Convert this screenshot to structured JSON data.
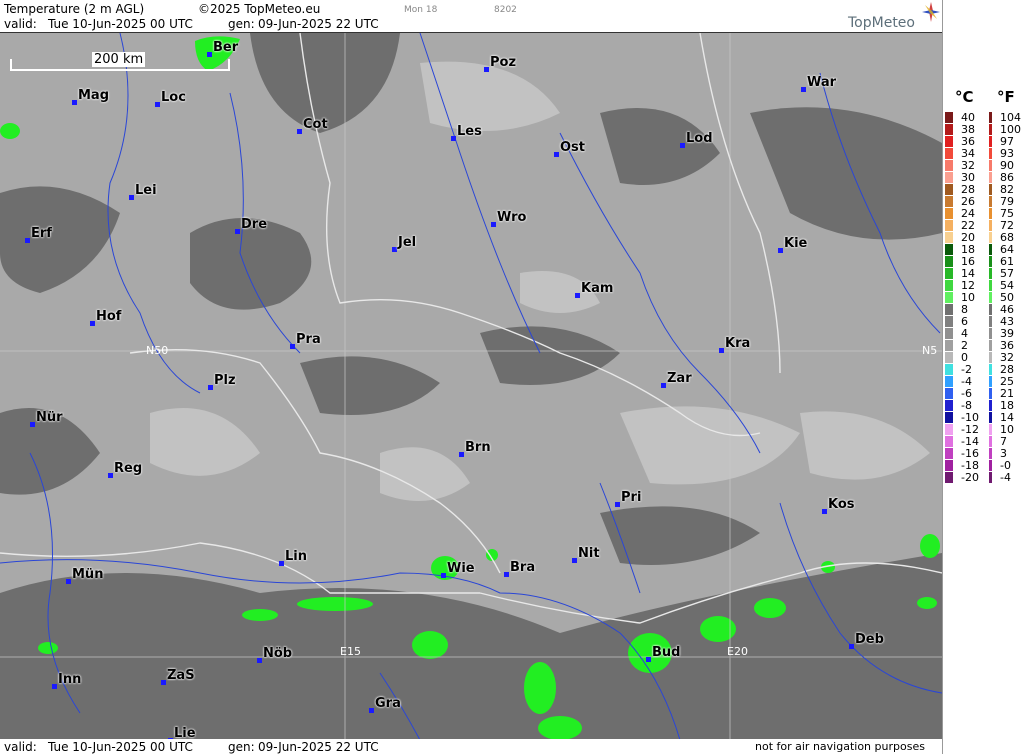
{
  "header": {
    "title": "Temperature (2 m AGL)",
    "copyright": "©2025 TopMeteo.eu",
    "model": "Mon 18",
    "code": "8202",
    "valid_label": "valid:",
    "valid_value": "Tue  10-Jun-2025  00 UTC",
    "gen_label": "gen:",
    "gen_value": "09-Jun-2025 22 UTC",
    "logo": "TopMeteo"
  },
  "footer": {
    "valid_label": "valid:",
    "valid_value": "Tue  10-Jun-2025  00 UTC",
    "gen_label": "gen:",
    "gen_value": "09-Jun-2025 22 UTC",
    "disclaimer": "not for air navigation purposes"
  },
  "map": {
    "scale": "200 km",
    "grid_labels": [
      "N50",
      "N5",
      "E15",
      "E20"
    ],
    "cities": [
      "Ber",
      "Poz",
      "War",
      "Mag",
      "Loc",
      "Cot",
      "Les",
      "Ost",
      "Lod",
      "Lei",
      "Dre",
      "Wro",
      "Erf",
      "Jel",
      "Kie",
      "Kam",
      "Hof",
      "Pra",
      "Kra",
      "Zar",
      "Plz",
      "Nür",
      "Brn",
      "Reg",
      "Pri",
      "Kos",
      "Lin",
      "Wie",
      "Bra",
      "Nit",
      "Mün",
      "Deb",
      "Nöb",
      "Bud",
      "Inn",
      "ZaS",
      "Gra",
      "Lie"
    ],
    "colors": {
      "background": "#a9a9a9",
      "rivers": "#2a46d6",
      "borders": "#e8e8e8",
      "warm_10": "#22ee22"
    }
  },
  "legend": {
    "celsius_label": "°C",
    "fahrenheit_label": "°F",
    "celsius": [
      "40",
      "38",
      "36",
      "34",
      "32",
      "30",
      "28",
      "26",
      "24",
      "22",
      "20",
      "18",
      "16",
      "14",
      "12",
      "10",
      "8",
      "6",
      "4",
      "2",
      "0",
      "-2",
      "-4",
      "-6",
      "-8",
      "-10",
      "-12",
      "-14",
      "-16",
      "-18",
      "-20"
    ],
    "fahrenheit": [
      "104",
      "100",
      "97",
      "93",
      "90",
      "86",
      "82",
      "79",
      "75",
      "72",
      "68",
      "64",
      "61",
      "57",
      "54",
      "50",
      "46",
      "43",
      "39",
      "36",
      "32",
      "28",
      "25",
      "21",
      "18",
      "14",
      "10",
      "7",
      "3",
      "-0",
      "-4"
    ],
    "colors": [
      "#7a1a1a",
      "#b31a1a",
      "#e02020",
      "#f24a3a",
      "#f77a6a",
      "#fa9f90",
      "#a05a20",
      "#c87a30",
      "#e89030",
      "#f5b060",
      "#f8d090",
      "#0a5a0a",
      "#1a901a",
      "#28b828",
      "#40d840",
      "#60f060",
      "#707070",
      "#808080",
      "#909090",
      "#a0a0a0",
      "#b8b8b8",
      "#40e0e0",
      "#30a0ff",
      "#3060f0",
      "#2020d0",
      "#1010a0",
      "#f0a0f0",
      "#e070e0",
      "#c040c0",
      "#a020a0",
      "#701a70"
    ]
  }
}
